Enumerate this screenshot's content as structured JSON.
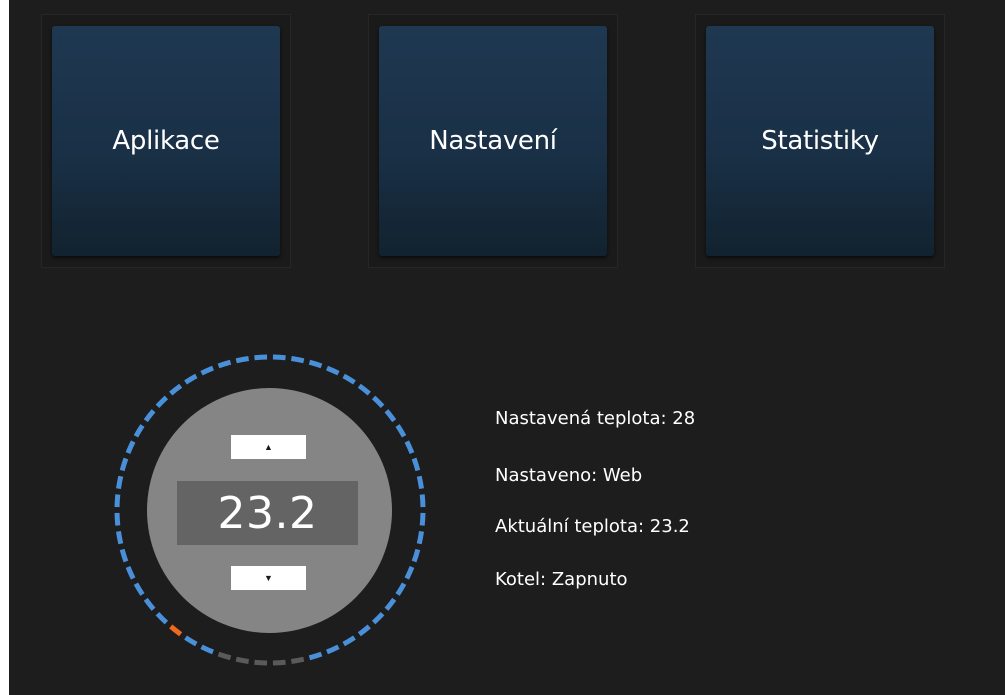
{
  "tiles": [
    {
      "label": "Aplikace"
    },
    {
      "label": "Nastavení"
    },
    {
      "label": "Statistiky"
    }
  ],
  "thermostat": {
    "current_value": "23.2",
    "up_icon": "caret-up-icon",
    "down_icon": "caret-down-icon",
    "up_glyph": "▲",
    "down_glyph": "▼",
    "ring_colors": {
      "normal": "#4a90d9",
      "marker": "#ef6a1f",
      "inactive": "#5a5a5a"
    }
  },
  "info": {
    "set_temperature": "Nastavená teplota: 28",
    "set_by": "Nastaveno: Web",
    "actual_temperature": "Aktuální teplota: 23.2",
    "boiler": "Kotel: Zapnuto"
  },
  "colors": {
    "background": "#1d1d1d",
    "tile_top": "#1f3851",
    "tile_bottom": "#12222f",
    "knob": "#858585",
    "readout": "#646464"
  }
}
